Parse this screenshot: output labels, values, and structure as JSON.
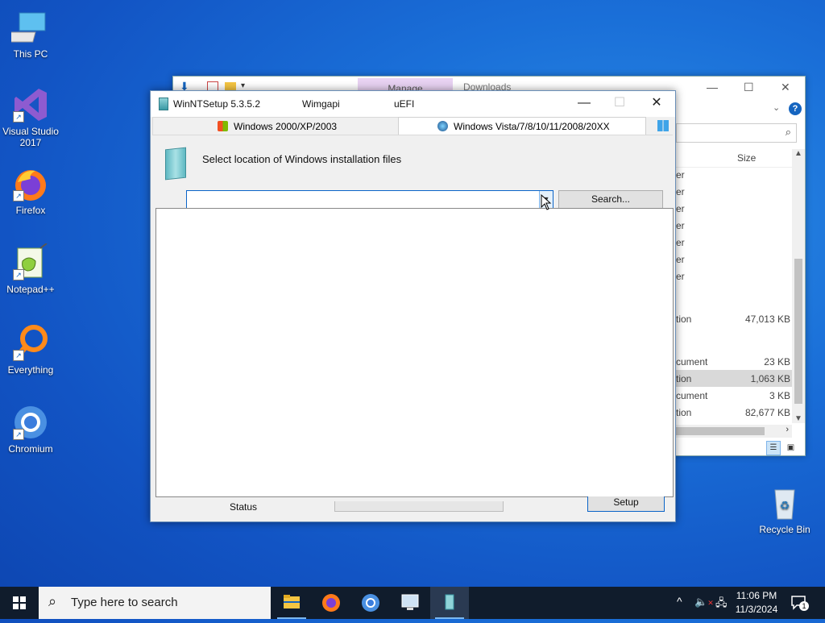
{
  "desktop": {
    "icons": [
      {
        "label": "This PC"
      },
      {
        "label": "Visual Studio 2017"
      },
      {
        "label": "Firefox"
      },
      {
        "label": "Notepad++"
      },
      {
        "label": "Everything"
      },
      {
        "label": "Chromium"
      },
      {
        "label": "Recycle Bin"
      }
    ]
  },
  "explorer": {
    "manage_tab": "Manage",
    "downloads_tab": "Downloads",
    "size_header": "Size",
    "rows": [
      {
        "type": "er",
        "size": ""
      },
      {
        "type": "er",
        "size": ""
      },
      {
        "type": "er",
        "size": ""
      },
      {
        "type": "er",
        "size": ""
      },
      {
        "type": "er",
        "size": ""
      },
      {
        "type": "er",
        "size": ""
      },
      {
        "type": "er",
        "size": ""
      },
      {
        "type": "tion",
        "size": "47,013 KB"
      },
      {
        "type": "cument",
        "size": "23 KB"
      },
      {
        "type": "tion",
        "size": "1,063 KB"
      },
      {
        "type": "cument",
        "size": "3 KB"
      },
      {
        "type": "tion",
        "size": "82,677 KB"
      }
    ]
  },
  "winnt": {
    "title": "WinNTSetup 5.3.5.2",
    "menu_wimgapi": "Wimgapi",
    "menu_uefi": "uEFI",
    "tab_legacy": "Windows 2000/XP/2003",
    "tab_modern": "Windows Vista/7/8/10/11/2008/20XX",
    "heading": "Select location of Windows installation files",
    "combo_value": "",
    "search_button": "Search...",
    "status_label": "Status",
    "setup_button": "Setup"
  },
  "taskbar": {
    "search_placeholder": "Type here to search",
    "time": "11:06 PM",
    "date": "11/3/2024",
    "notification_count": "1"
  }
}
